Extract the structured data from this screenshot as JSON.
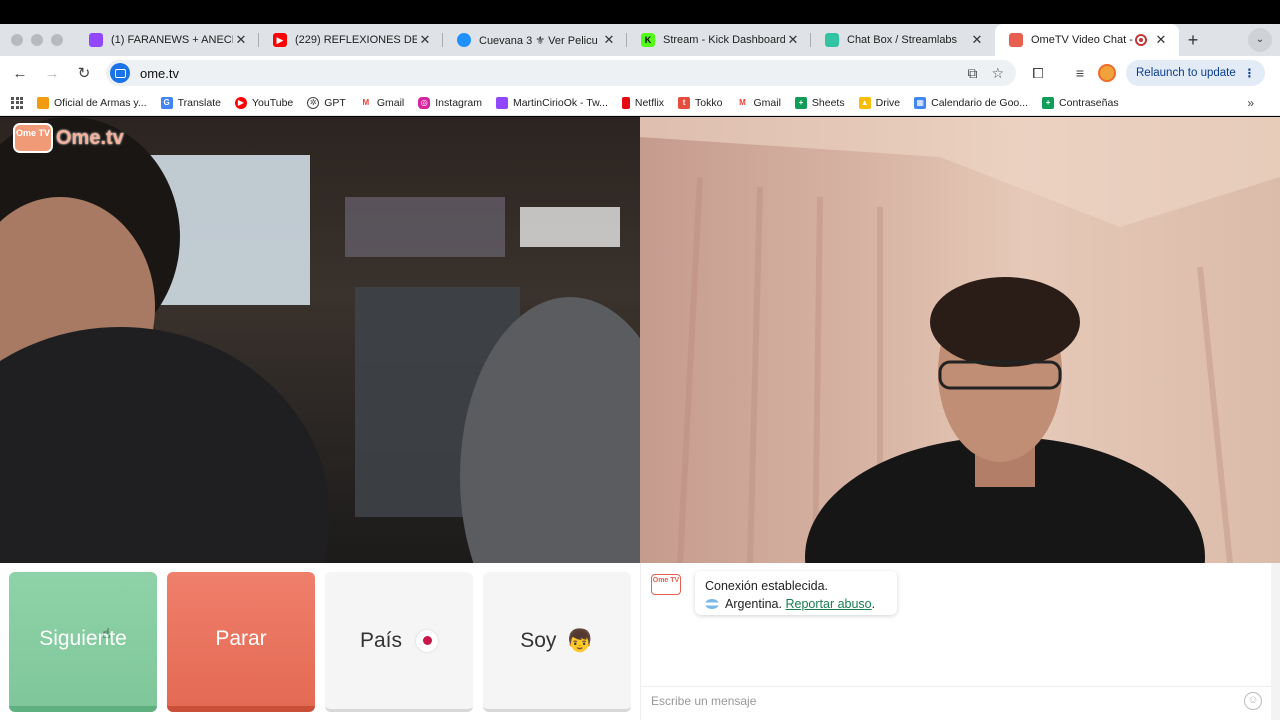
{
  "tabs": [
    {
      "title": "(1) FARANEWS + ANECD",
      "fav_color": "#9146ff",
      "icon": "twitch-icon"
    },
    {
      "title": "(229) REFLEXIONES DE",
      "fav_color": "#ff0000",
      "icon": "youtube-icon"
    },
    {
      "title": "Cuevana 3 ⚜ Ver Pelicu",
      "fav_color": "#1e90ff",
      "icon": "cuevana-icon"
    },
    {
      "title": "Stream - Kick Dashboard",
      "fav_color": "#53fc18",
      "icon": "kick-icon"
    },
    {
      "title": "Chat Box / Streamlabs",
      "fav_color": "#31c3a2",
      "icon": "streamlabs-icon"
    },
    {
      "title": "OmeTV Video Chat -",
      "fav_color": "#e7604f",
      "icon": "ometv-icon",
      "active": true
    }
  ],
  "address": {
    "url": "ome.tv"
  },
  "toolbar": {
    "relaunch_label": "Relaunch to update"
  },
  "bookmarks": [
    {
      "label": "Oficial de Armas y...",
      "color": "#f39c12",
      "icon": "ometv-bookmark-icon"
    },
    {
      "label": "Translate",
      "color": "#4285f4",
      "icon": "translate-icon"
    },
    {
      "label": "YouTube",
      "color": "#ff0000",
      "icon": "youtube-icon"
    },
    {
      "label": "GPT",
      "color": "#444444",
      "icon": "openai-icon"
    },
    {
      "label": "Gmail",
      "color": "#ea4335",
      "icon": "gmail-icon"
    },
    {
      "label": "Instagram",
      "color": "#d6249f",
      "icon": "instagram-icon"
    },
    {
      "label": "MartinCirioOk - Tw...",
      "color": "#9146ff",
      "icon": "twitch-icon"
    },
    {
      "label": "Netflix",
      "color": "#e50914",
      "icon": "netflix-icon"
    },
    {
      "label": "Tokko",
      "color": "#e74c3c",
      "icon": "tokko-icon"
    },
    {
      "label": "Gmail",
      "color": "#ea4335",
      "icon": "gmail-icon"
    },
    {
      "label": "Sheets",
      "color": "#0f9d58",
      "icon": "sheets-icon"
    },
    {
      "label": "Drive",
      "color": "#fbbc04",
      "icon": "drive-icon"
    },
    {
      "label": "Calendario de Goo...",
      "color": "#4285f4",
      "icon": "calendar-icon"
    },
    {
      "label": "Contraseñas",
      "color": "#0f9d58",
      "icon": "passwords-icon"
    }
  ],
  "logo": {
    "text": "Ome.tv",
    "badge": "Ome TV"
  },
  "controls": {
    "next_label": "Siguiente",
    "stop_label": "Parar",
    "country_label": "País",
    "gender_label": "Soy",
    "gender_emoji": "👦"
  },
  "chat": {
    "status": "Conexión establecida.",
    "country": "Argentina.",
    "report_label": "Reportar abuso",
    "report_suffix": ".",
    "input_placeholder": "Escribe un mensaje"
  }
}
